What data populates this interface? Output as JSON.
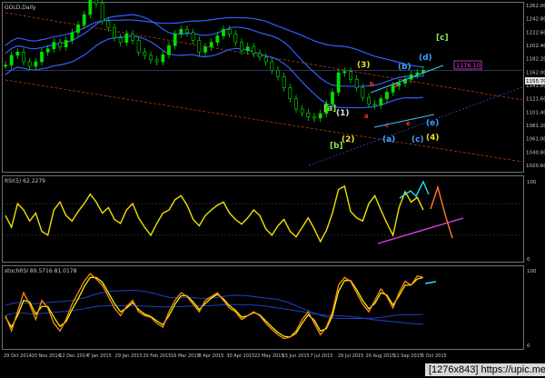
{
  "window": {
    "symbol_label": "GOLD,Daily",
    "panel2_label": "RSI(5) 62.2279",
    "panel3_label": "stochRSI 89.5716 81.0178",
    "watermark": "[1276x843] https://upic.me/"
  },
  "colors": {
    "background": "#000000",
    "candle_up": "#00e000",
    "candle_down": "#00c000",
    "ma_blue": "#3060ff",
    "channel_orange": "#b04010",
    "wave_yellow": "#e8e020",
    "wave_green": "#90e050",
    "wave_cyan": "#40a0ff",
    "wave_red": "#ff3020",
    "rsi": "#f0e000",
    "stoch_orange": "#ff8c1a",
    "stoch_yellow": "#ffff00",
    "magenta": "#e040e0",
    "aqua": "#20e0ff"
  },
  "chart_data": [
    {
      "type": "line",
      "title": "GOLD,Daily",
      "x": [
        "29 Oct 2014",
        "20 Nov 2014",
        "12 Dec 2014",
        "7 Jan 2015",
        "29 Jan 2015",
        "20 Feb 2015",
        "16 Mar 2015",
        "8 Apr 2015",
        "30 Apr 2015",
        "22 May 2015",
        "15 Jun 2015",
        "7 Jul 2015",
        "29 Jul 2015",
        "20 Aug 2015",
        "11 Sep 2015",
        "5 Oct 2015"
      ],
      "y_ticks": [
        "1262.00",
        "1242.80",
        "1222.60",
        "1202.40",
        "1182.20",
        "1162.00",
        "1141.80",
        "1121.60",
        "1101.40",
        "1081.20",
        "1061.00",
        "1040.80",
        "1020.60"
      ],
      "ylim": [
        1020.6,
        1262.0
      ],
      "series": [
        {
          "values": [
            1170,
            1185,
            1190,
            1175,
            1168,
            1175,
            1190,
            1195,
            1205,
            1198,
            1208,
            1220,
            1232,
            1248,
            1275,
            1265,
            1238,
            1228,
            1212,
            1205,
            1218,
            1208,
            1190,
            1185,
            1178,
            1175,
            1186,
            1200,
            1218,
            1225,
            1220,
            1208,
            1190,
            1198,
            1205,
            1215,
            1225,
            1218,
            1205,
            1192,
            1198,
            1188,
            1182,
            1175,
            1162,
            1152,
            1135,
            1118,
            1102,
            1096,
            1090,
            1088,
            1095,
            1110,
            1128,
            1158,
            1160,
            1148,
            1135,
            1120,
            1110,
            1108,
            1118,
            1128,
            1138,
            1142,
            1148,
            1155,
            1158,
            1162
          ]
        }
      ],
      "annotations": [
        {
          "text": "(3)",
          "color": "yellow"
        },
        {
          "text": "(2)",
          "color": "yellow"
        },
        {
          "text": "(4)",
          "color": "yellow"
        },
        {
          "text": "[a]",
          "color": "green"
        },
        {
          "text": "[b]",
          "color": "green"
        },
        {
          "text": "[c]",
          "color": "green"
        },
        {
          "text": "(a)",
          "color": "cyan"
        },
        {
          "text": "(b)",
          "color": "cyan"
        },
        {
          "text": "(c)",
          "color": "cyan"
        },
        {
          "text": "(d)",
          "color": "cyan"
        },
        {
          "text": "(e)",
          "color": "cyan"
        },
        {
          "text": "(1)",
          "color": "white"
        },
        {
          "text": "a",
          "color": "red"
        },
        {
          "text": "b",
          "color": "red"
        },
        {
          "text": "c",
          "color": "red"
        },
        {
          "text": "d",
          "color": "red"
        },
        {
          "text": "e",
          "color": "red"
        }
      ],
      "price_tags": [
        "1176.10",
        "1155.70"
      ]
    },
    {
      "type": "line",
      "title": "RSI(5) 62.2279",
      "y_ticks": [
        "100",
        "0"
      ],
      "ylim": [
        0,
        100
      ],
      "series": [
        {
          "values": [
            55,
            40,
            70,
            62,
            48,
            58,
            35,
            30,
            62,
            72,
            55,
            48,
            60,
            70,
            82,
            72,
            58,
            65,
            50,
            45,
            62,
            70,
            52,
            40,
            30,
            45,
            58,
            62,
            75,
            80,
            68,
            50,
            42,
            55,
            62,
            68,
            72,
            58,
            50,
            44,
            52,
            62,
            55,
            38,
            30,
            42,
            50,
            35,
            28,
            40,
            52,
            38,
            22,
            36,
            58,
            88,
            92,
            60,
            52,
            48,
            70,
            80,
            62,
            45,
            30,
            65,
            85,
            72,
            78,
            62
          ]
        }
      ]
    },
    {
      "type": "line",
      "title": "stochRSI 89.5716 81.0178",
      "y_ticks": [
        "100",
        "0"
      ],
      "ylim": [
        0,
        100
      ],
      "series": [
        {
          "values": [
            40,
            20,
            45,
            70,
            55,
            35,
            60,
            50,
            30,
            20,
            35,
            55,
            70,
            85,
            95,
            88,
            80,
            65,
            50,
            40,
            52,
            60,
            45,
            40,
            38,
            30,
            25,
            45,
            60,
            70,
            65,
            55,
            45,
            60,
            65,
            70,
            60,
            50,
            45,
            35,
            40,
            45,
            40,
            30,
            22,
            15,
            10,
            12,
            20,
            35,
            45,
            30,
            15,
            25,
            45,
            80,
            90,
            85,
            70,
            55,
            45,
            60,
            75,
            65,
            50,
            70,
            85,
            80,
            92,
            90
          ]
        },
        {
          "values": [
            38,
            25,
            40,
            60,
            58,
            42,
            52,
            52,
            38,
            26,
            32,
            48,
            62,
            78,
            90,
            90,
            84,
            70,
            56,
            45,
            50,
            57,
            48,
            42,
            39,
            33,
            28,
            40,
            55,
            66,
            66,
            58,
            48,
            56,
            63,
            68,
            62,
            53,
            47,
            38,
            40,
            44,
            41,
            33,
            25,
            18,
            13,
            12,
            17,
            30,
            41,
            34,
            20,
            23,
            40,
            72,
            86,
            86,
            74,
            60,
            49,
            56,
            70,
            67,
            54,
            66,
            80,
            80,
            88,
            90
          ]
        }
      ]
    }
  ]
}
